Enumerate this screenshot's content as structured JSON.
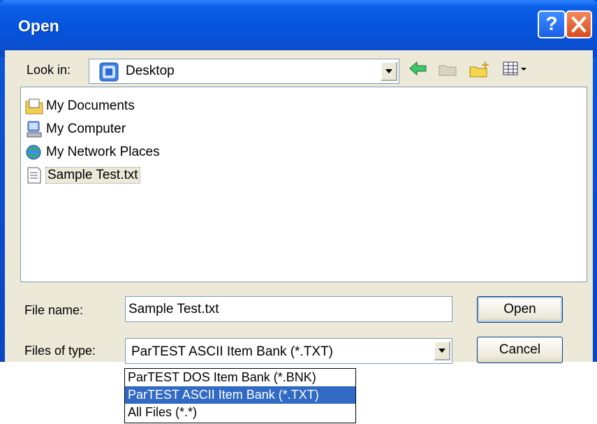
{
  "window": {
    "title": "Open",
    "help_label": "?",
    "close_label": "X"
  },
  "lookin": {
    "label": "Look in:",
    "value": "Desktop"
  },
  "files": [
    {
      "name": "My Documents",
      "icon": "folder-documents-icon"
    },
    {
      "name": "My Computer",
      "icon": "computer-icon"
    },
    {
      "name": "My Network Places",
      "icon": "network-places-icon"
    },
    {
      "name": "Sample Test.txt",
      "icon": "text-file-icon",
      "selected": true
    }
  ],
  "filename": {
    "label": "File name:",
    "value": "Sample Test.txt"
  },
  "filetype": {
    "label": "Files of type:",
    "value": "ParTEST ASCII Item Bank (*.TXT)",
    "options": [
      "ParTEST DOS Item Bank (*.BNK)",
      "ParTEST ASCII Item Bank (*.TXT)",
      "All Files (*.*)"
    ],
    "selected_index": 1
  },
  "buttons": {
    "open": "Open",
    "cancel": "Cancel"
  }
}
